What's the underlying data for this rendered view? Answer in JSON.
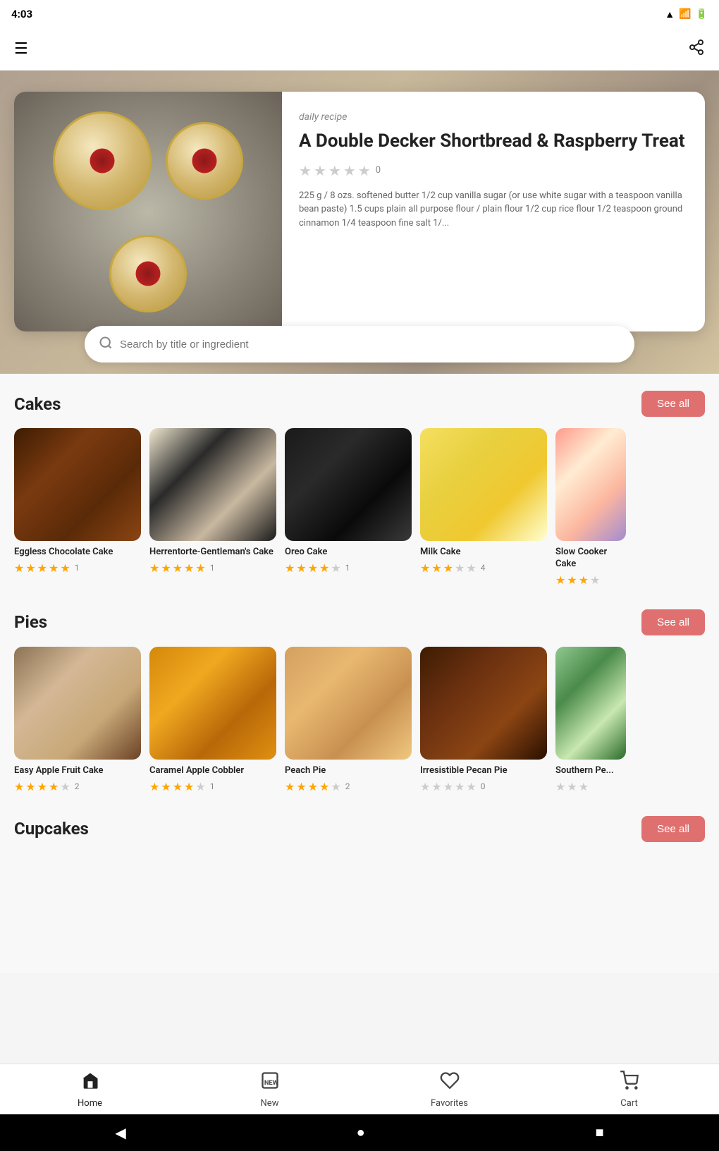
{
  "statusBar": {
    "time": "4:03",
    "wifiIcon": "wifi",
    "signalIcon": "signal",
    "batteryIcon": "battery"
  },
  "appBar": {
    "menuIcon": "hamburger-menu",
    "shareIcon": "share"
  },
  "hero": {
    "dailyLabel": "daily recipe",
    "dailyTitle": "A Double Decker Shortbread & Raspberry Treat",
    "ratingCount": "0",
    "description": "225 g / 8 ozs. softened butter 1/2 cup vanilla sugar (or use white sugar with a teaspoon vanilla bean paste) 1.5 cups plain all purpose flour / plain flour 1/2 cup rice flour 1/2 teaspoon ground cinnamon 1/4 teaspoon fine salt 1/..."
  },
  "search": {
    "placeholder": "Search by title or ingredient"
  },
  "cakes": {
    "sectionTitle": "Cakes",
    "seeAllLabel": "See all",
    "items": [
      {
        "name": "Eggless Chocolate Cake",
        "rating": 4.5,
        "ratingCount": "1",
        "filledStars": 4,
        "halfStar": true,
        "emptyStars": 0,
        "imgClass": "img-eggless-choc"
      },
      {
        "name": "Herrentorte-Gentleman's Cake",
        "rating": 5,
        "ratingCount": "1",
        "filledStars": 5,
        "halfStar": false,
        "emptyStars": 0,
        "imgClass": "img-herren"
      },
      {
        "name": "Oreo Cake",
        "rating": 4,
        "ratingCount": "1",
        "filledStars": 4,
        "halfStar": false,
        "emptyStars": 1,
        "imgClass": "img-oreo"
      },
      {
        "name": "Milk Cake",
        "rating": 3,
        "ratingCount": "4",
        "filledStars": 3,
        "halfStar": false,
        "emptyStars": 2,
        "imgClass": "img-milk-cake"
      },
      {
        "name": "Slow Cooker Cake",
        "rating": 3,
        "ratingCount": "",
        "filledStars": 3,
        "halfStar": false,
        "emptyStars": 2,
        "imgClass": "img-slow-cooker",
        "partial": true
      }
    ]
  },
  "pies": {
    "sectionTitle": "Pies",
    "seeAllLabel": "See all",
    "items": [
      {
        "name": "Easy Apple Fruit Cake",
        "rating": 4,
        "ratingCount": "2",
        "filledStars": 4,
        "halfStar": false,
        "emptyStars": 1,
        "imgClass": "img-apple-fruit"
      },
      {
        "name": "Caramel Apple Cobbler",
        "rating": 3.5,
        "ratingCount": "1",
        "filledStars": 3,
        "halfStar": true,
        "emptyStars": 1,
        "imgClass": "img-caramel"
      },
      {
        "name": "Peach Pie",
        "rating": 4,
        "ratingCount": "2",
        "filledStars": 4,
        "halfStar": false,
        "emptyStars": 1,
        "imgClass": "img-peach-pie"
      },
      {
        "name": "Irresistible Pecan Pie",
        "rating": 0,
        "ratingCount": "0",
        "filledStars": 0,
        "halfStar": false,
        "emptyStars": 5,
        "imgClass": "img-pecan"
      },
      {
        "name": "Southern Pe...",
        "rating": 0,
        "ratingCount": "",
        "filledStars": 0,
        "halfStar": false,
        "emptyStars": 5,
        "imgClass": "img-southern",
        "partial": true
      }
    ]
  },
  "cupcakes": {
    "sectionTitle": "Cupcakes",
    "seeAllLabel": "See all"
  },
  "bottomNav": {
    "items": [
      {
        "id": "home",
        "label": "Home",
        "icon": "🏠",
        "active": true
      },
      {
        "id": "new",
        "label": "New",
        "icon": "🆕",
        "active": false
      },
      {
        "id": "favorites",
        "label": "Favorites",
        "icon": "♡",
        "active": false
      },
      {
        "id": "cart",
        "label": "Cart",
        "icon": "🛒",
        "active": false
      }
    ]
  },
  "androidNav": {
    "backLabel": "◀",
    "homeLabel": "●",
    "recentLabel": "■"
  }
}
